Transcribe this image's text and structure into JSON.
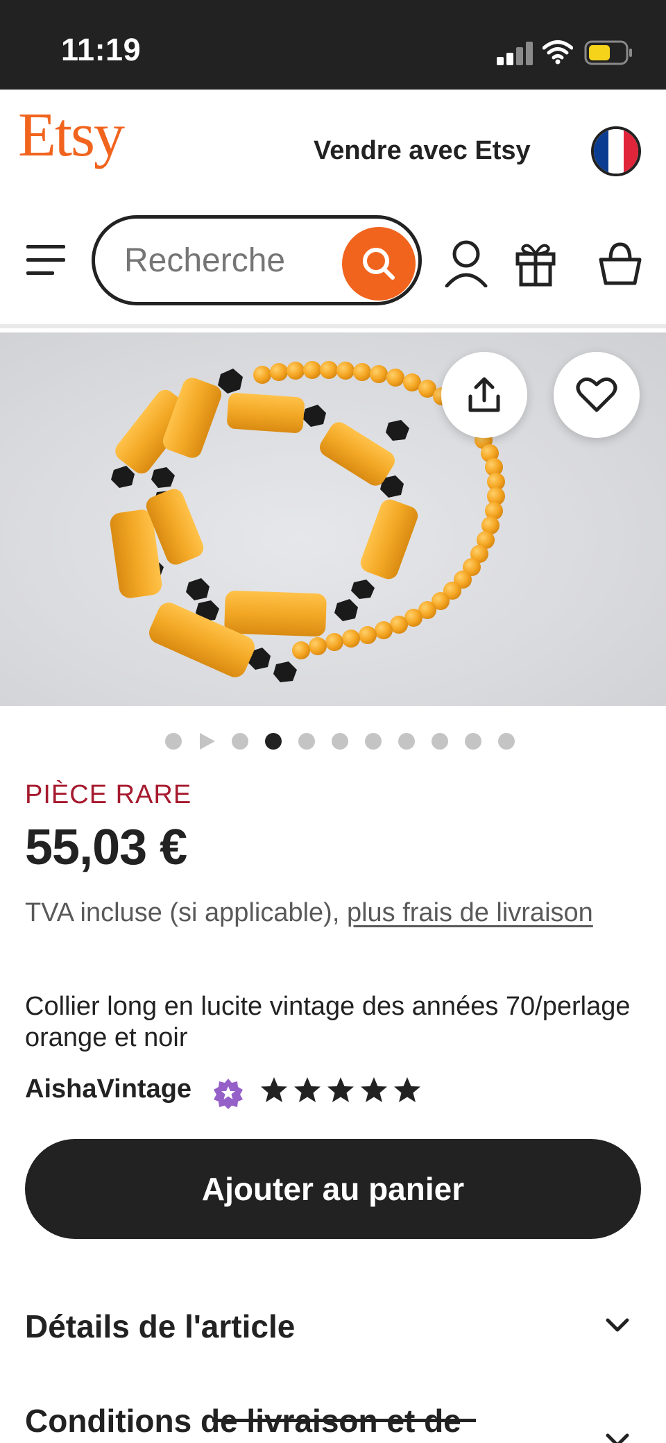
{
  "status_bar": {
    "time": "11:19"
  },
  "header": {
    "logo": "Etsy",
    "sell_link": "Vendre avec Etsy",
    "search_placeholder": "Recherche"
  },
  "product": {
    "badge": "PIÈCE RARE",
    "price": "55,03 €",
    "vat_text": "TVA incluse (si applicable), ",
    "shipping_link": "plus frais de livraison",
    "title": "Collier long en lucite vintage des années 70/perlage orange et noir",
    "shop_name": "AishaVintage",
    "rating_stars": 5
  },
  "carousel": {
    "total_slides": 11,
    "active_index": 3,
    "video_index": 1
  },
  "actions": {
    "add_to_cart": "Ajouter au panier"
  },
  "sections": {
    "details_label": "Détails de l'article",
    "shipping_label": "Conditions de livraison et de"
  },
  "colors": {
    "brand_orange": "#f1641e",
    "text_dark": "#222222",
    "badge_red": "#a61a2e",
    "star_seller_purple": "#9560c8"
  }
}
